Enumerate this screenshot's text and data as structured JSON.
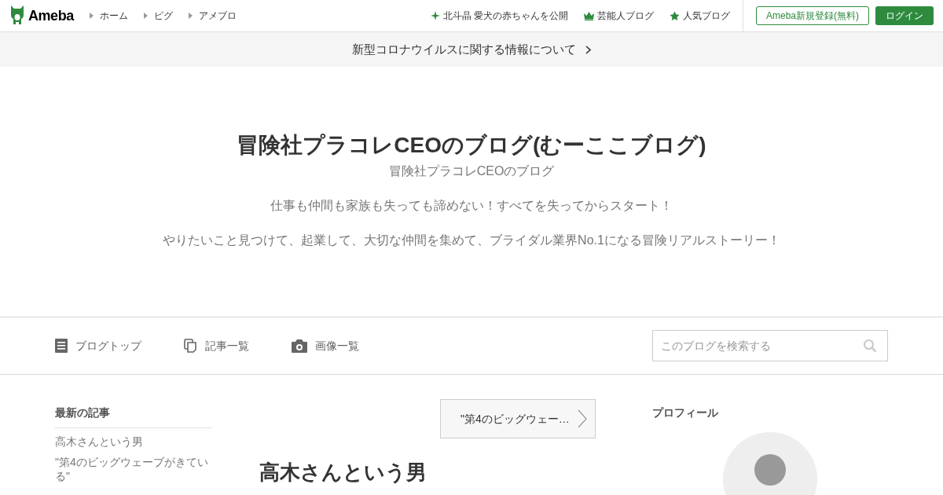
{
  "header": {
    "logo": "Ameba",
    "nav": [
      "ホーム",
      "ピグ",
      "アメブロ"
    ],
    "links": [
      {
        "kind": "sparkle",
        "label": "北斗晶 愛犬の赤ちゃんを公開"
      },
      {
        "kind": "crown",
        "label": "芸能人ブログ"
      },
      {
        "kind": "star",
        "label": "人気ブログ"
      }
    ],
    "register_button": "Ameba新規登録(無料)",
    "login_button": "ログイン"
  },
  "notice": "新型コロナウイルスに関する情報について",
  "blog": {
    "title": "冒険社プラコレCEOのブログ(むーここブログ)",
    "subtitle": "冒険社プラコレCEOのブログ",
    "description": [
      "仕事も仲間も家族も失っても諦めない！すべてを失ってからスタート！",
      "やりたいこと見つけて、起業して、大切な仲間を集めて、ブライダル業界No.1になる冒険リアルストーリー！"
    ]
  },
  "blog_nav": [
    {
      "kind": "document",
      "label": "ブログトップ"
    },
    {
      "kind": "copy",
      "label": "記事一覧"
    },
    {
      "kind": "camera",
      "label": "画像一覧"
    }
  ],
  "search": {
    "placeholder": "このブログを検索する"
  },
  "sidebar": {
    "heading": "最新の記事",
    "items": [
      "高木さんという男",
      "\"第4のビッグウェーブがきている\""
    ]
  },
  "article": {
    "next_link": "\"第4のビッグウェー…",
    "title": "高木さんという男"
  },
  "profile": {
    "heading": "プロフィール"
  }
}
